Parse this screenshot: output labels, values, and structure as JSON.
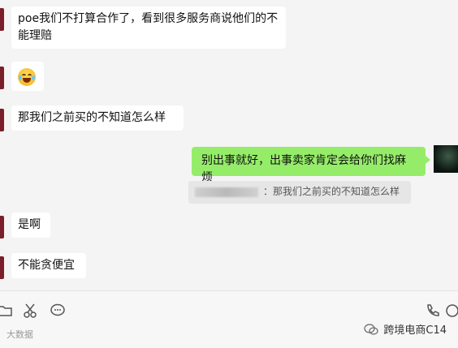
{
  "messages": [
    {
      "side": "in",
      "text": "poe我们不打算合作了，看到很多服务商说他们的不能理赔"
    },
    {
      "side": "in",
      "emoji": "laugh-cry-emoji"
    },
    {
      "side": "in",
      "text": "那我们之前买的不知道怎么样"
    },
    {
      "side": "out",
      "text": "别出事就好，出事卖家肯定会给你们找麻烦"
    },
    {
      "side": "quote",
      "text": "：那我们之前买的不知道怎么样"
    },
    {
      "side": "in",
      "text": "是啊"
    },
    {
      "side": "in",
      "text": "不能贪便宜"
    }
  ],
  "toolbar": {
    "icons": [
      "folder-icon",
      "scissors-icon",
      "chat-icon",
      "phone-icon",
      "video-icon"
    ]
  },
  "watermark": {
    "left": "大数据",
    "right": "跨境电商C14"
  }
}
